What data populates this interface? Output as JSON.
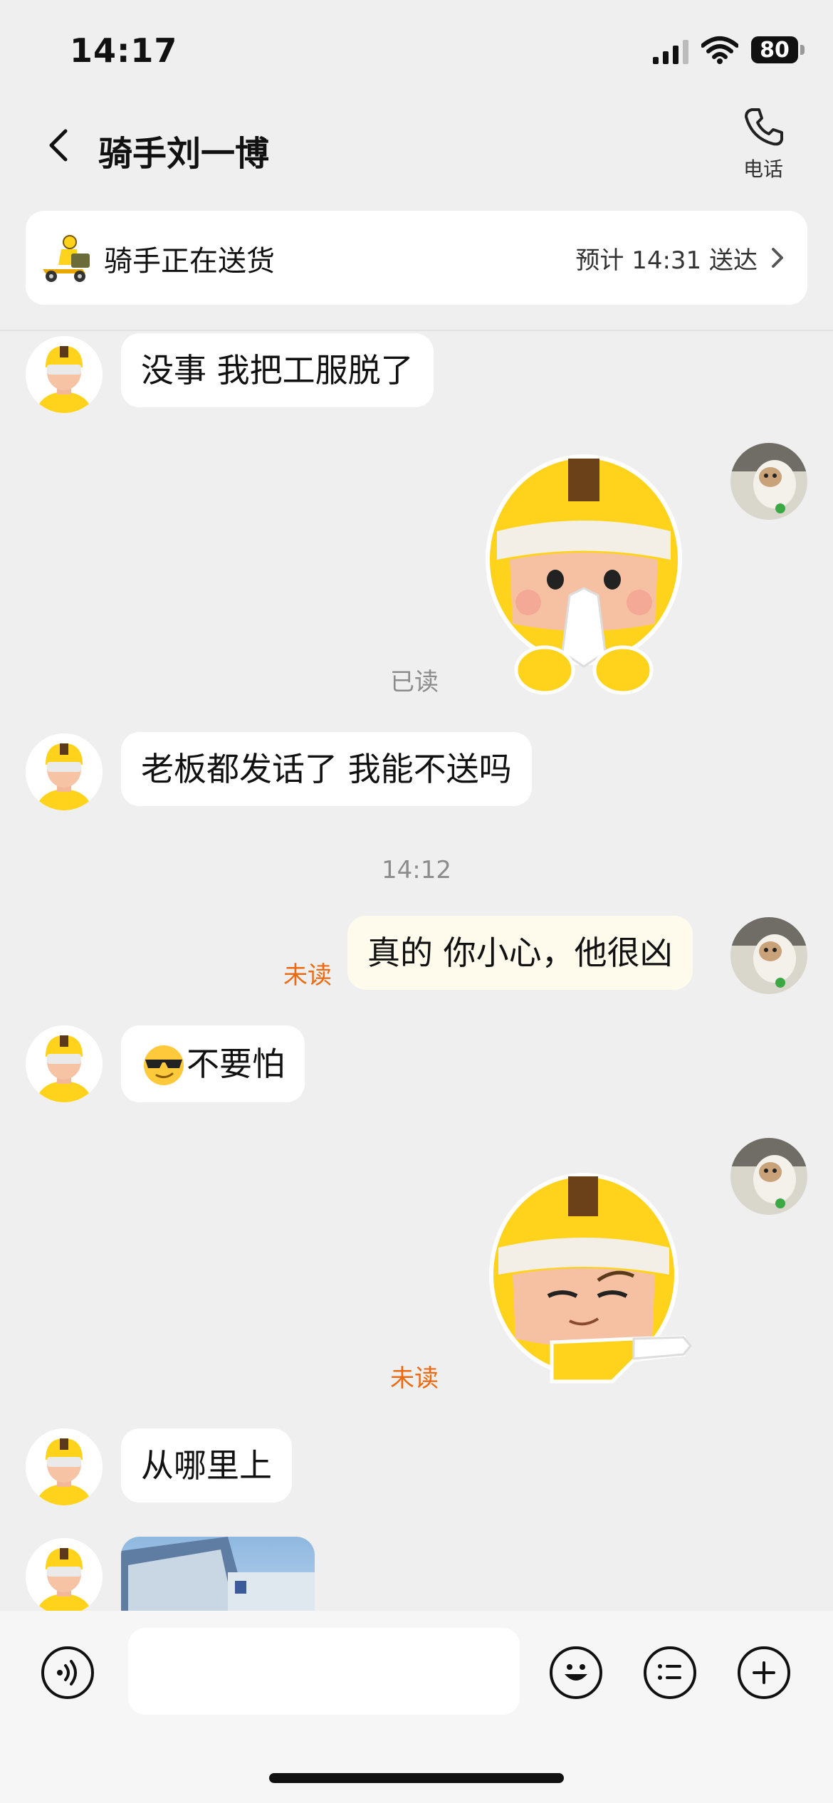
{
  "status_bar": {
    "time": "14:17",
    "battery": "80"
  },
  "header": {
    "title": "骑手刘一博",
    "phone_label": "电话"
  },
  "delivery": {
    "status": "骑手正在送货",
    "eta": "预计 14:31 送达"
  },
  "messages": {
    "m1": "没事 我把工服脱了",
    "read_label": "已读",
    "m3": "老板都发话了 我能不送吗",
    "time_1412": "14:12",
    "m4": "真的 你小心，他很凶",
    "unread_label_1": "未读",
    "m5": "不要怕",
    "unread_label_2": "未读",
    "m7": "从哪里上"
  },
  "colors": {
    "accent_yellow": "#ffd31c",
    "unread_orange": "#ee6a10",
    "outgoing_bubble": "#fefbec"
  },
  "icons": [
    "back-icon",
    "phone-icon",
    "delivery-scooter-icon",
    "chevron-right-icon",
    "voice-icon",
    "emoji-icon",
    "list-icon",
    "plus-icon"
  ]
}
